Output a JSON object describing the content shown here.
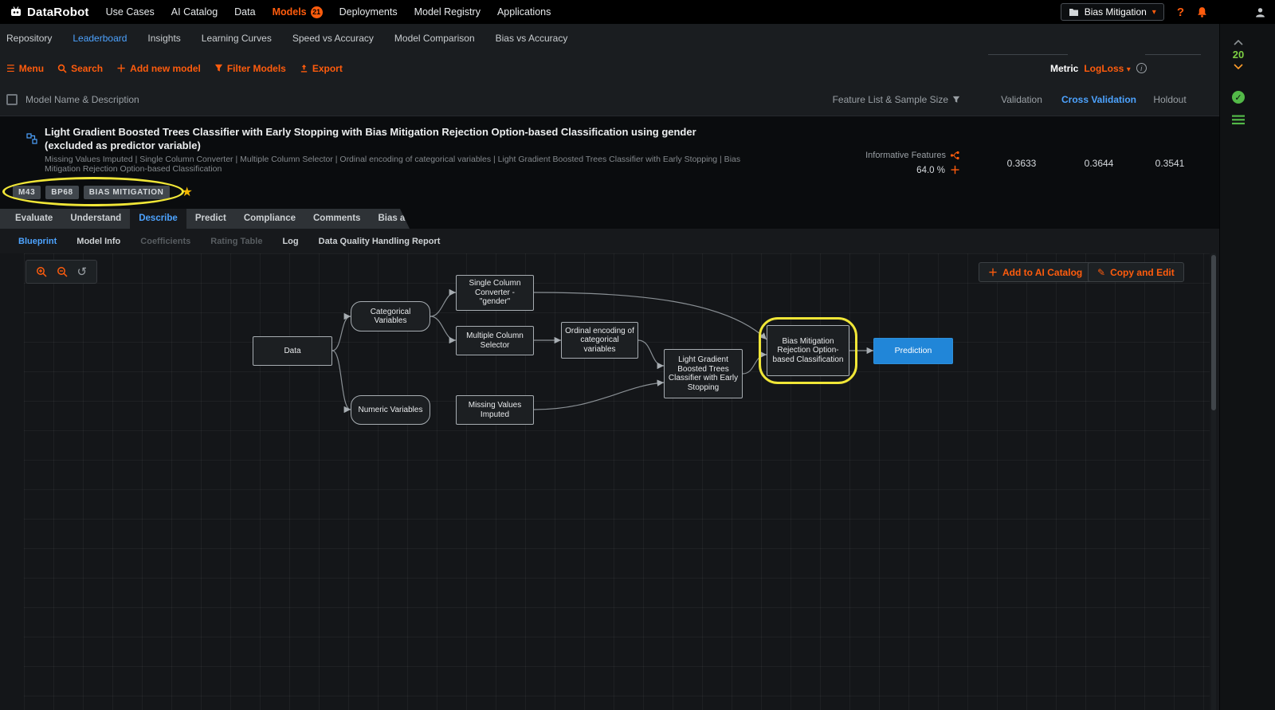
{
  "colors": {
    "accent_orange": "#ff5c0d",
    "link_blue": "#4da3ff",
    "highlight_yellow": "#f0e637",
    "success_green": "#53b948",
    "prediction_blue": "#2186d8"
  },
  "topnav": {
    "brand": "DataRobot",
    "items": [
      {
        "label": "Use Cases"
      },
      {
        "label": "AI Catalog"
      },
      {
        "label": "Data"
      },
      {
        "label": "Models",
        "badge": "21"
      },
      {
        "label": "Deployments"
      },
      {
        "label": "Model Registry"
      },
      {
        "label": "Applications"
      }
    ],
    "project_name": "Bias Mitigation",
    "help": "?"
  },
  "subnav": {
    "items": [
      {
        "label": "Repository"
      },
      {
        "label": "Leaderboard"
      },
      {
        "label": "Insights"
      },
      {
        "label": "Learning Curves"
      },
      {
        "label": "Speed vs Accuracy"
      },
      {
        "label": "Model Comparison"
      },
      {
        "label": "Bias vs Accuracy"
      }
    ]
  },
  "toolbar": {
    "menu": "Menu",
    "search": "Search",
    "add_new_model": "Add new model",
    "filter_models": "Filter Models",
    "export": "Export",
    "metric_label": "Metric",
    "metric_value": "LogLoss"
  },
  "leaderboard": {
    "header": {
      "model_name": "Model Name & Description",
      "feature_list": "Feature List & Sample Size",
      "validation": "Validation",
      "cross_validation": "Cross Validation",
      "holdout": "Holdout"
    },
    "model": {
      "title": "Light Gradient Boosted Trees Classifier with Early Stopping with Bias Mitigation Rejection Option-based Classification using gender (excluded as predictor variable)",
      "description": "Missing Values Imputed | Single Column Converter | Multiple Column Selector | Ordinal encoding of categorical variables | Light Gradient Boosted Trees Classifier with Early Stopping | Bias Mitigation Rejection Option-based Classification",
      "badges": [
        "M43",
        "BP68",
        "BIAS MITIGATION"
      ],
      "feature_list": "Informative Features",
      "sample_size": "64.0 %",
      "validation": "0.3633",
      "cross_validation": "0.3644",
      "holdout": "0.3541"
    }
  },
  "tabs": {
    "items": [
      {
        "label": "Evaluate"
      },
      {
        "label": "Understand"
      },
      {
        "label": "Describe"
      },
      {
        "label": "Predict"
      },
      {
        "label": "Compliance"
      },
      {
        "label": "Comments"
      },
      {
        "label": "Bias and Fairness"
      }
    ]
  },
  "subtabs": {
    "items": [
      {
        "label": "Blueprint"
      },
      {
        "label": "Model Info"
      },
      {
        "label": "Coefficients"
      },
      {
        "label": "Rating Table"
      },
      {
        "label": "Log"
      },
      {
        "label": "Data Quality Handling Report"
      }
    ]
  },
  "blueprint": {
    "add_to_catalog": "Add to AI Catalog",
    "copy_and_edit": "Copy and Edit",
    "nodes": {
      "data": "Data",
      "categorical": "Categorical Variables",
      "numeric": "Numeric Variables",
      "single_column_converter": "Single Column Converter - \"gender\"",
      "multiple_column_selector": "Multiple Column Selector",
      "ordinal_encoding": "Ordinal encoding of categorical variables",
      "missing_values": "Missing Values Imputed",
      "lgbt_classifier": "Light Gradient Boosted Trees Classifier with Early Stopping",
      "bias_mitigation": "Bias Mitigation Rejection Option-based Classification",
      "prediction": "Prediction"
    }
  },
  "right_rail": {
    "worker_count": "20"
  }
}
